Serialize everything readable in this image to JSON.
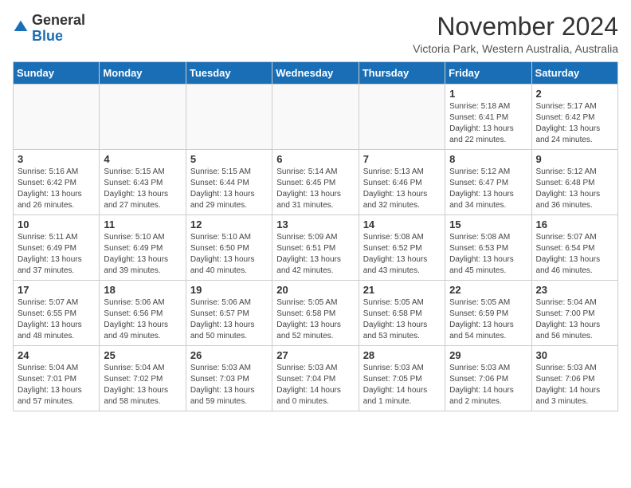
{
  "logo": {
    "general": "General",
    "blue": "Blue"
  },
  "header": {
    "month_title": "November 2024",
    "location": "Victoria Park, Western Australia, Australia"
  },
  "weekdays": [
    "Sunday",
    "Monday",
    "Tuesday",
    "Wednesday",
    "Thursday",
    "Friday",
    "Saturday"
  ],
  "weeks": [
    [
      {
        "day": "",
        "info": ""
      },
      {
        "day": "",
        "info": ""
      },
      {
        "day": "",
        "info": ""
      },
      {
        "day": "",
        "info": ""
      },
      {
        "day": "",
        "info": ""
      },
      {
        "day": "1",
        "info": "Sunrise: 5:18 AM\nSunset: 6:41 PM\nDaylight: 13 hours\nand 22 minutes."
      },
      {
        "day": "2",
        "info": "Sunrise: 5:17 AM\nSunset: 6:42 PM\nDaylight: 13 hours\nand 24 minutes."
      }
    ],
    [
      {
        "day": "3",
        "info": "Sunrise: 5:16 AM\nSunset: 6:42 PM\nDaylight: 13 hours\nand 26 minutes."
      },
      {
        "day": "4",
        "info": "Sunrise: 5:15 AM\nSunset: 6:43 PM\nDaylight: 13 hours\nand 27 minutes."
      },
      {
        "day": "5",
        "info": "Sunrise: 5:15 AM\nSunset: 6:44 PM\nDaylight: 13 hours\nand 29 minutes."
      },
      {
        "day": "6",
        "info": "Sunrise: 5:14 AM\nSunset: 6:45 PM\nDaylight: 13 hours\nand 31 minutes."
      },
      {
        "day": "7",
        "info": "Sunrise: 5:13 AM\nSunset: 6:46 PM\nDaylight: 13 hours\nand 32 minutes."
      },
      {
        "day": "8",
        "info": "Sunrise: 5:12 AM\nSunset: 6:47 PM\nDaylight: 13 hours\nand 34 minutes."
      },
      {
        "day": "9",
        "info": "Sunrise: 5:12 AM\nSunset: 6:48 PM\nDaylight: 13 hours\nand 36 minutes."
      }
    ],
    [
      {
        "day": "10",
        "info": "Sunrise: 5:11 AM\nSunset: 6:49 PM\nDaylight: 13 hours\nand 37 minutes."
      },
      {
        "day": "11",
        "info": "Sunrise: 5:10 AM\nSunset: 6:49 PM\nDaylight: 13 hours\nand 39 minutes."
      },
      {
        "day": "12",
        "info": "Sunrise: 5:10 AM\nSunset: 6:50 PM\nDaylight: 13 hours\nand 40 minutes."
      },
      {
        "day": "13",
        "info": "Sunrise: 5:09 AM\nSunset: 6:51 PM\nDaylight: 13 hours\nand 42 minutes."
      },
      {
        "day": "14",
        "info": "Sunrise: 5:08 AM\nSunset: 6:52 PM\nDaylight: 13 hours\nand 43 minutes."
      },
      {
        "day": "15",
        "info": "Sunrise: 5:08 AM\nSunset: 6:53 PM\nDaylight: 13 hours\nand 45 minutes."
      },
      {
        "day": "16",
        "info": "Sunrise: 5:07 AM\nSunset: 6:54 PM\nDaylight: 13 hours\nand 46 minutes."
      }
    ],
    [
      {
        "day": "17",
        "info": "Sunrise: 5:07 AM\nSunset: 6:55 PM\nDaylight: 13 hours\nand 48 minutes."
      },
      {
        "day": "18",
        "info": "Sunrise: 5:06 AM\nSunset: 6:56 PM\nDaylight: 13 hours\nand 49 minutes."
      },
      {
        "day": "19",
        "info": "Sunrise: 5:06 AM\nSunset: 6:57 PM\nDaylight: 13 hours\nand 50 minutes."
      },
      {
        "day": "20",
        "info": "Sunrise: 5:05 AM\nSunset: 6:58 PM\nDaylight: 13 hours\nand 52 minutes."
      },
      {
        "day": "21",
        "info": "Sunrise: 5:05 AM\nSunset: 6:58 PM\nDaylight: 13 hours\nand 53 minutes."
      },
      {
        "day": "22",
        "info": "Sunrise: 5:05 AM\nSunset: 6:59 PM\nDaylight: 13 hours\nand 54 minutes."
      },
      {
        "day": "23",
        "info": "Sunrise: 5:04 AM\nSunset: 7:00 PM\nDaylight: 13 hours\nand 56 minutes."
      }
    ],
    [
      {
        "day": "24",
        "info": "Sunrise: 5:04 AM\nSunset: 7:01 PM\nDaylight: 13 hours\nand 57 minutes."
      },
      {
        "day": "25",
        "info": "Sunrise: 5:04 AM\nSunset: 7:02 PM\nDaylight: 13 hours\nand 58 minutes."
      },
      {
        "day": "26",
        "info": "Sunrise: 5:03 AM\nSunset: 7:03 PM\nDaylight: 13 hours\nand 59 minutes."
      },
      {
        "day": "27",
        "info": "Sunrise: 5:03 AM\nSunset: 7:04 PM\nDaylight: 14 hours\nand 0 minutes."
      },
      {
        "day": "28",
        "info": "Sunrise: 5:03 AM\nSunset: 7:05 PM\nDaylight: 14 hours\nand 1 minute."
      },
      {
        "day": "29",
        "info": "Sunrise: 5:03 AM\nSunset: 7:06 PM\nDaylight: 14 hours\nand 2 minutes."
      },
      {
        "day": "30",
        "info": "Sunrise: 5:03 AM\nSunset: 7:06 PM\nDaylight: 14 hours\nand 3 minutes."
      }
    ]
  ]
}
